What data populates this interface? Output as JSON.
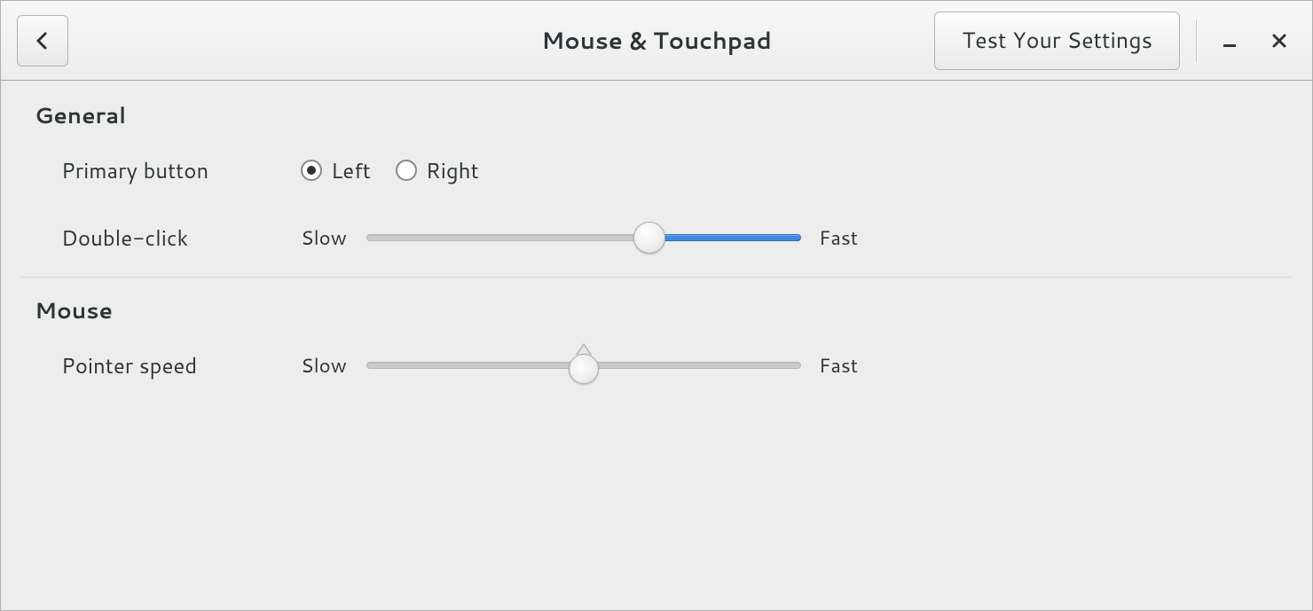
{
  "header": {
    "title": "Mouse & Touchpad",
    "test_button": "Test Your Settings"
  },
  "general": {
    "title": "General",
    "primary_button": {
      "label": "Primary button",
      "options": {
        "left": "Left",
        "right": "Right"
      },
      "selected": "left"
    },
    "double_click": {
      "label": "Double-click",
      "slow": "Slow",
      "fast": "Fast",
      "value_percent": 65
    }
  },
  "mouse": {
    "title": "Mouse",
    "pointer_speed": {
      "label": "Pointer speed",
      "slow": "Slow",
      "fast": "Fast",
      "value_percent": 50
    }
  }
}
